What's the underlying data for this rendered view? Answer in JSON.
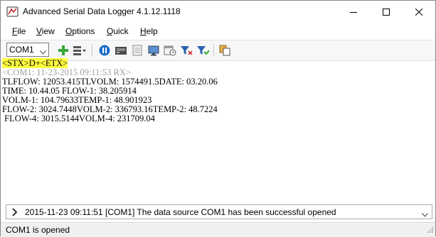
{
  "window": {
    "title": "Advanced Serial Data Logger 4.1.12.1118"
  },
  "menu": {
    "file": "File",
    "view": "View",
    "options": "Options",
    "quick": "Quick",
    "help": "Help"
  },
  "toolbar": {
    "port_value": "COM1",
    "icons": [
      "add-icon",
      "list-icon",
      "pause-icon",
      "terminal-icon",
      "document-icon",
      "monitor-icon",
      "schedule-icon",
      "filter-icon",
      "filter-green-icon",
      "copy-icon"
    ]
  },
  "terminal": {
    "marker": "<STX>D+<ETX>",
    "rx_header": "<COM1: 11-23-2015 09:11:53 RX>",
    "lines": [
      "TLFLOW: 12053.415TLVOLM: 1574491.5DATE: 03.20.06",
      "TIME: 10.44.05 FLOW-1: 38.205914",
      "VOLM-1: 104.79633TEMP-1: 48.901923",
      "FLOW-2: 3024.7448VOLM-2: 336793.16TEMP-2: 48.7224",
      " FLOW-4: 3015.5144VOLM-4: 231709.04"
    ]
  },
  "log": {
    "message": "2015-11-23 09:11:51 [COM1] The data source COM1 has been successful opened"
  },
  "status": {
    "text": "COM1 is opened"
  },
  "colors": {
    "marker_bg": "#ffff40",
    "rx_text": "#a0a0a0",
    "play_blue": "#1a6fc9",
    "add_green": "#3aa53a"
  }
}
